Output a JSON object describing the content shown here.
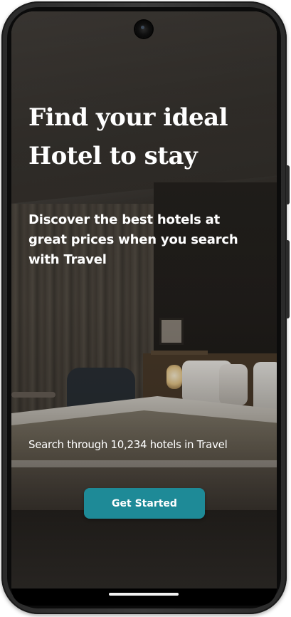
{
  "onboarding": {
    "headline_line1": "Find your ideal",
    "headline_line2": "Hotel to stay",
    "description_line1": "Discover the best hotels at",
    "description_line2": "great prices when you search",
    "description_line3": "with Travel",
    "search_count_text": "Search through 10,234 hotels in Travel",
    "cta_label": "Get Started"
  },
  "colors": {
    "accent": "#1E8A97",
    "text": "#FFFFFF",
    "device_frame": "#2B2B2B"
  },
  "icons": {
    "camera": "front-camera-icon",
    "home": "home-indicator"
  }
}
